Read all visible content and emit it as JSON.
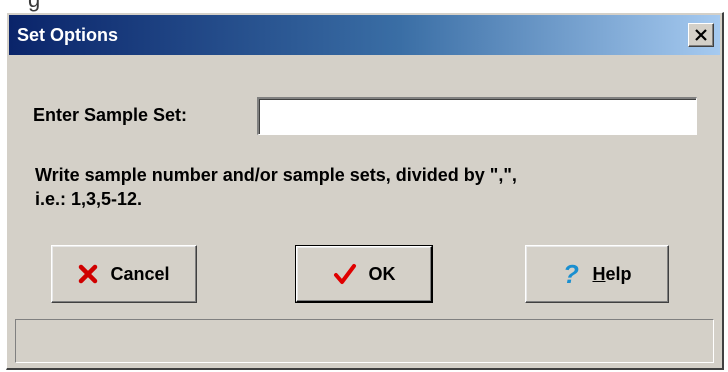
{
  "background_text": "g",
  "window": {
    "title": "Set Options",
    "close_label": "Close"
  },
  "form": {
    "sample_set_label": "Enter Sample Set:",
    "sample_set_value": "",
    "hint_line1": "Write sample number and/or sample sets, divided by \",\",",
    "hint_line2": "i.e.: 1,3,5-12."
  },
  "buttons": {
    "cancel": {
      "label": "Cancel",
      "icon": "x-icon",
      "color": "#d00000"
    },
    "ok": {
      "label": "OK",
      "icon": "checkmark-icon",
      "color": "#e00000"
    },
    "help": {
      "label_underlined": "H",
      "label_rest": "elp",
      "icon": "question-icon",
      "color": "#1a8fd0"
    }
  },
  "status_bar": {
    "text": ""
  },
  "colors": {
    "dialog_face": "#d4d0c8",
    "titlebar_start": "#0a246a",
    "titlebar_end": "#a6caf0"
  }
}
